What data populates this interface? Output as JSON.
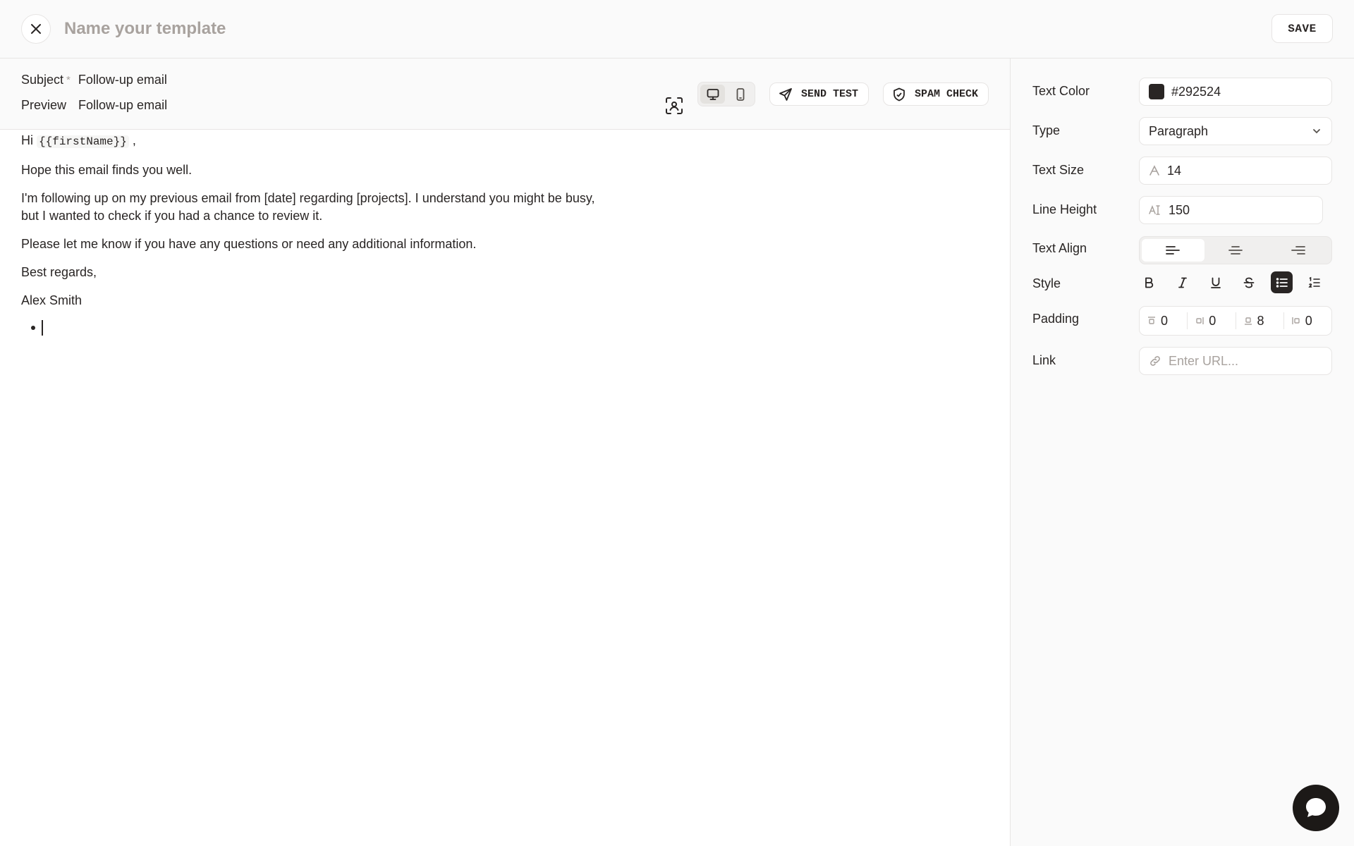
{
  "header": {
    "template_name_placeholder": "Name your template",
    "save_label": "SAVE"
  },
  "meta": {
    "subject_label": "Subject",
    "subject_required": "*",
    "subject_value": "Follow-up email",
    "preview_label": "Preview",
    "preview_value": "Follow-up email"
  },
  "toolbar": {
    "send_test_label": "SEND TEST",
    "spam_check_label": "SPAM CHECK",
    "device_active": "desktop"
  },
  "email_body": {
    "greeting_prefix": "Hi",
    "greeting_variable": "{{firstName}}",
    "greeting_suffix": ",",
    "p1": "Hope this email finds you well.",
    "p2": "I'm following up on my previous email from [date] regarding [projects]. I understand you might be busy, but I wanted to check if you had a chance to review it.",
    "p3": "Please let me know if you have any questions or need any additional information.",
    "p4": "Best regards,",
    "p5": "Alex Smith"
  },
  "properties": {
    "text_color_label": "Text Color",
    "text_color_value": "#292524",
    "type_label": "Type",
    "type_value": "Paragraph",
    "text_size_label": "Text Size",
    "text_size_value": "14",
    "line_height_label": "Line Height",
    "line_height_value": "150",
    "text_align_label": "Text Align",
    "text_align_active": "left",
    "style_label": "Style",
    "style_active": "bulleted-list",
    "padding_label": "Padding",
    "padding": {
      "top": "0",
      "right": "0",
      "bottom": "8",
      "left": "0"
    },
    "link_label": "Link",
    "link_placeholder": "Enter URL..."
  },
  "colors": {
    "text": "#292524",
    "muted": "#a8a29e",
    "border": "#e7e5e4",
    "panel_bg": "#fafafa"
  }
}
